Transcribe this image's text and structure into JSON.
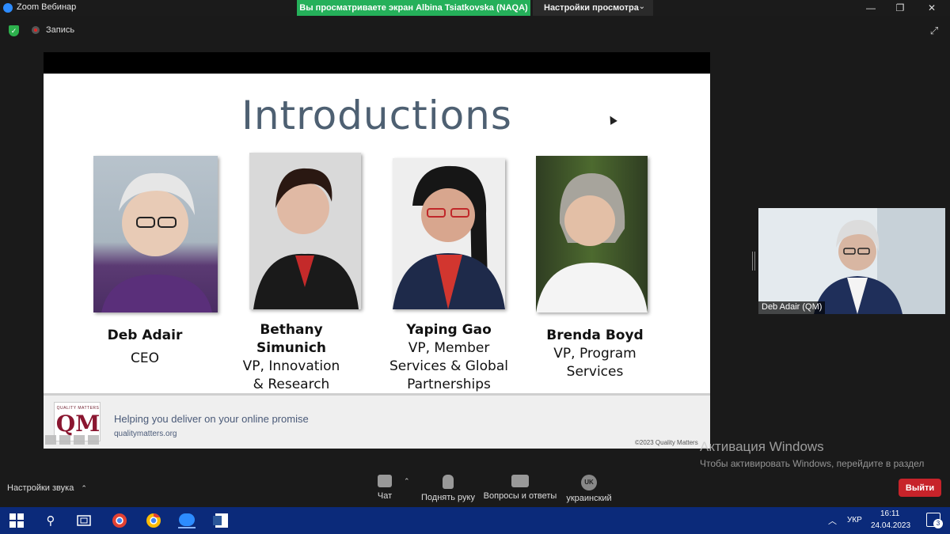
{
  "window": {
    "title": "Zoom Вебинар"
  },
  "share_banner": {
    "text": "Вы просматриваете экран Albina Tsiatkovska (NAQA)",
    "view_options": "Настройки просмотра"
  },
  "recording": {
    "label": "Запись"
  },
  "slide": {
    "title": "Introductions",
    "people": [
      {
        "name": "Deb Adair",
        "role": "CEO"
      },
      {
        "name": "Bethany Simunich",
        "role": "VP, Innovation & Research"
      },
      {
        "name": "Yaping Gao",
        "role": "VP, Member Services & Global Partnerships"
      },
      {
        "name": "Brenda Boyd",
        "role": "VP, Program Services"
      }
    ],
    "footer": {
      "logo_small": "QUALITY MATTERS",
      "logo_big": "QM",
      "tagline": "Helping you deliver on your online promise",
      "url": "qualitymatters.org",
      "copyright": "©2023 Quality Matters"
    }
  },
  "self_view": {
    "name": "Deb Adair (QM)"
  },
  "watermark": {
    "title": "Активация Windows",
    "line": "Чтобы активировать Windows, перейдите в раздел \"Параметры\"."
  },
  "bottom_bar": {
    "audio_settings": "Настройки звука",
    "chat": "Чат",
    "raise_hand": "Поднять руку",
    "qa": "Вопросы и ответы",
    "language_badge": "UK",
    "language": "украинский",
    "exit": "Выйти"
  },
  "taskbar": {
    "lang": "УКР",
    "time": "16:11",
    "date": "24.04.2023",
    "notifications": "3"
  },
  "colors": {
    "share_green": "#25b05a",
    "exit_red": "#c7232a",
    "taskbar_blue": "#0b2a7a",
    "title_gray": "#4e6072"
  }
}
